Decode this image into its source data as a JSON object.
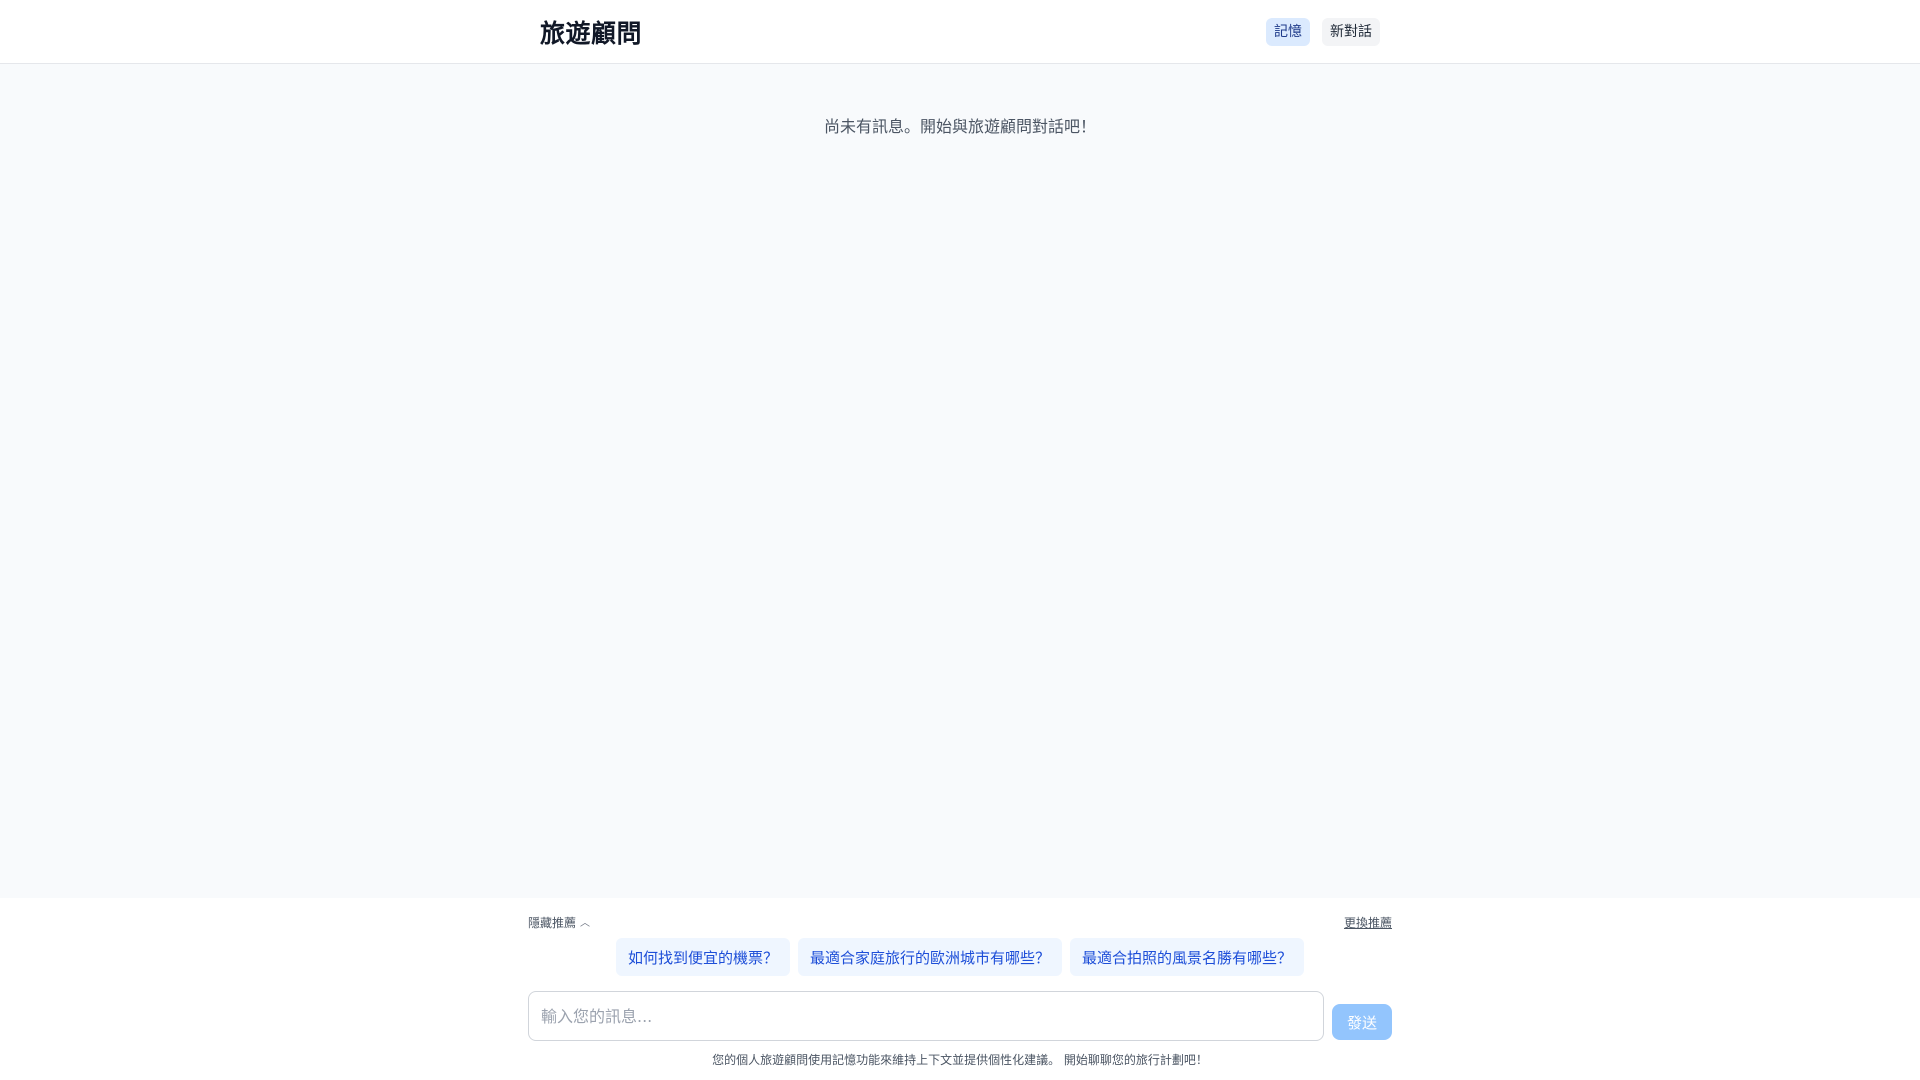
{
  "header": {
    "title": "旅遊顧問",
    "memory_label": "記憶",
    "new_chat_label": "新對話"
  },
  "messages": {
    "empty_text": "尚未有訊息。開始與旅遊顧問對話吧！"
  },
  "suggestions": {
    "hide_label": "隱藏推薦",
    "refresh_label": "更換推薦",
    "items": [
      "如何找到便宜的機票？",
      "最適合家庭旅行的歐洲城市有哪些？",
      "最適合拍照的風景名勝有哪些？"
    ]
  },
  "composer": {
    "placeholder": "輸入您的訊息...",
    "send_label": "發送"
  },
  "footer": {
    "note": "您的個人旅遊顧問使用記憶功能來維持上下文並提供個性化建議。 開始聊聊您的旅行計劃吧！"
  },
  "icons": {
    "hide_toggle": "chevron-up-icon"
  },
  "colors": {
    "accent": "#1d4ed8",
    "chip_bg": "#eff6ff",
    "send_disabled": "#93c5fd",
    "active_button_bg": "#dbeafe"
  }
}
